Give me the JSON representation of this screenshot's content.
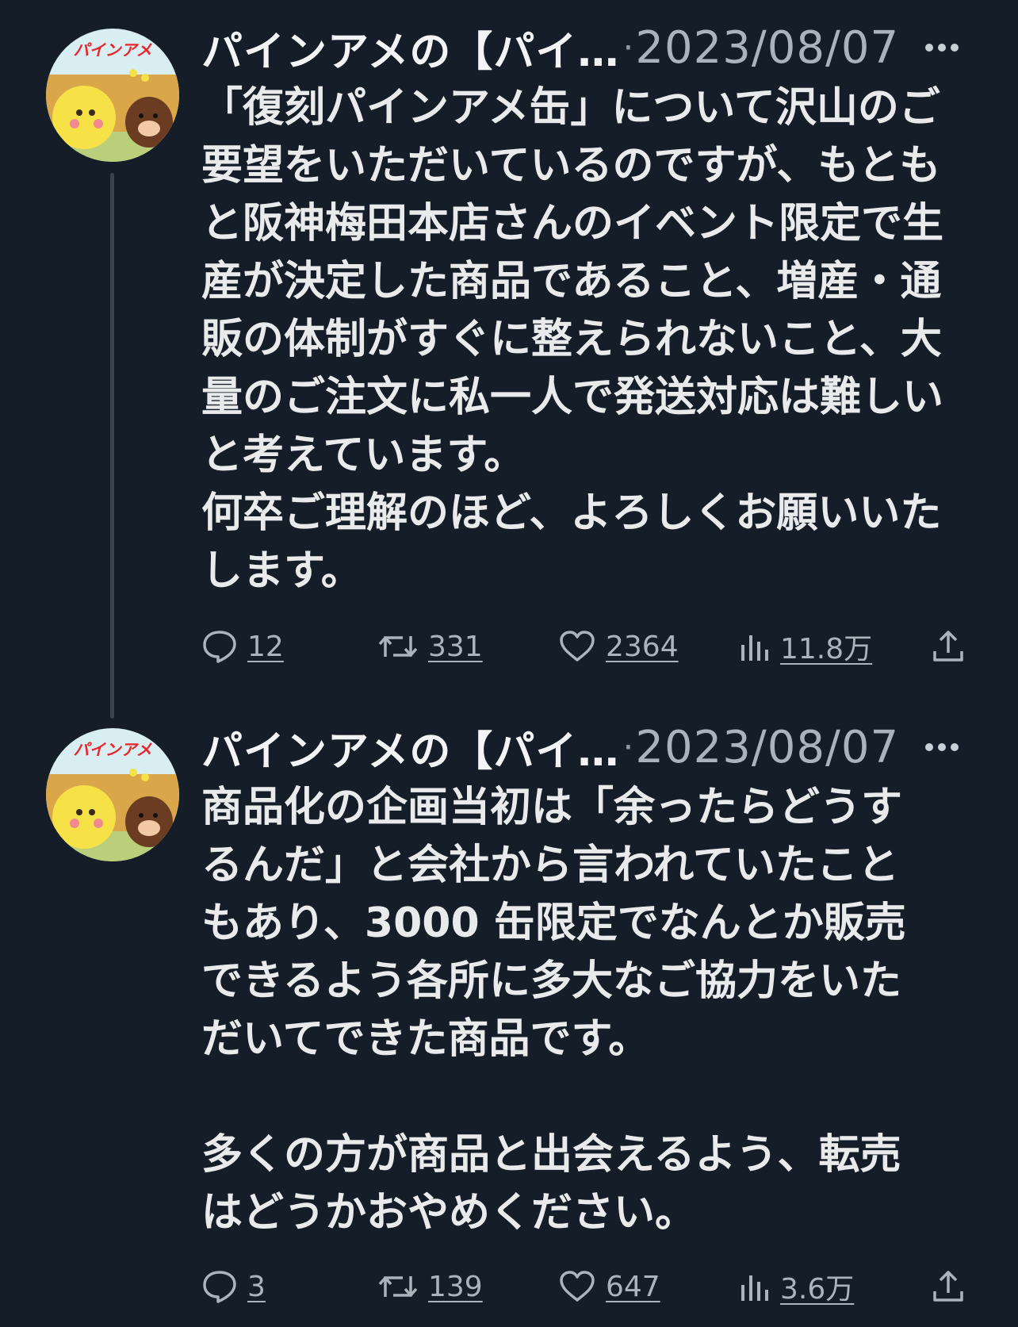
{
  "tweets": [
    {
      "author_name": "パインアメの【パイ…",
      "separator": "·",
      "date": "2023/08/07",
      "avatar_label": "パインアメ",
      "text_lines": [
        "「復刻パインアメ缶」について沢山のご",
        "要望をいただいているのですが、もとも",
        "と阪神梅田本店さんのイベント限定で生",
        "産が決定した商品であること、増産・通",
        "販の体制がすぐに整えられないこと、大",
        "量のご注文に私一人で発送対応は難しい",
        "と考えています。",
        "何卒ご理解のほど、よろしくお願いいた",
        "します。"
      ],
      "replies": "12",
      "retweets": "331",
      "likes": "2364",
      "views": "11.8万"
    },
    {
      "author_name": "パインアメの【パイ…",
      "separator": "·",
      "date": "2023/08/07",
      "avatar_label": "パインアメ",
      "text_lines": [
        "商品化の企画当初は「余ったらどうす",
        "るんだ」と会社から言われていたこと",
        "もあり、3000 缶限定でなんとか販売",
        "できるよう各所に多大なご協力をいた",
        "だいてできた商品です。",
        "",
        "多くの方が商品と出会えるよう、転売",
        "はどうかおやめください。"
      ],
      "replies": "3",
      "retweets": "139",
      "likes": "647",
      "views": "3.6万"
    }
  ],
  "icons": {
    "more": "more-icon",
    "reply": "reply-icon",
    "retweet": "retweet-icon",
    "like": "heart-icon",
    "views": "views-icon",
    "share": "share-icon"
  },
  "colors": {
    "background": "#151d28",
    "text": "#e7e9ea",
    "muted": "#aab4bd",
    "thread_line": "#3a434e",
    "logo_red": "#e8262b"
  }
}
